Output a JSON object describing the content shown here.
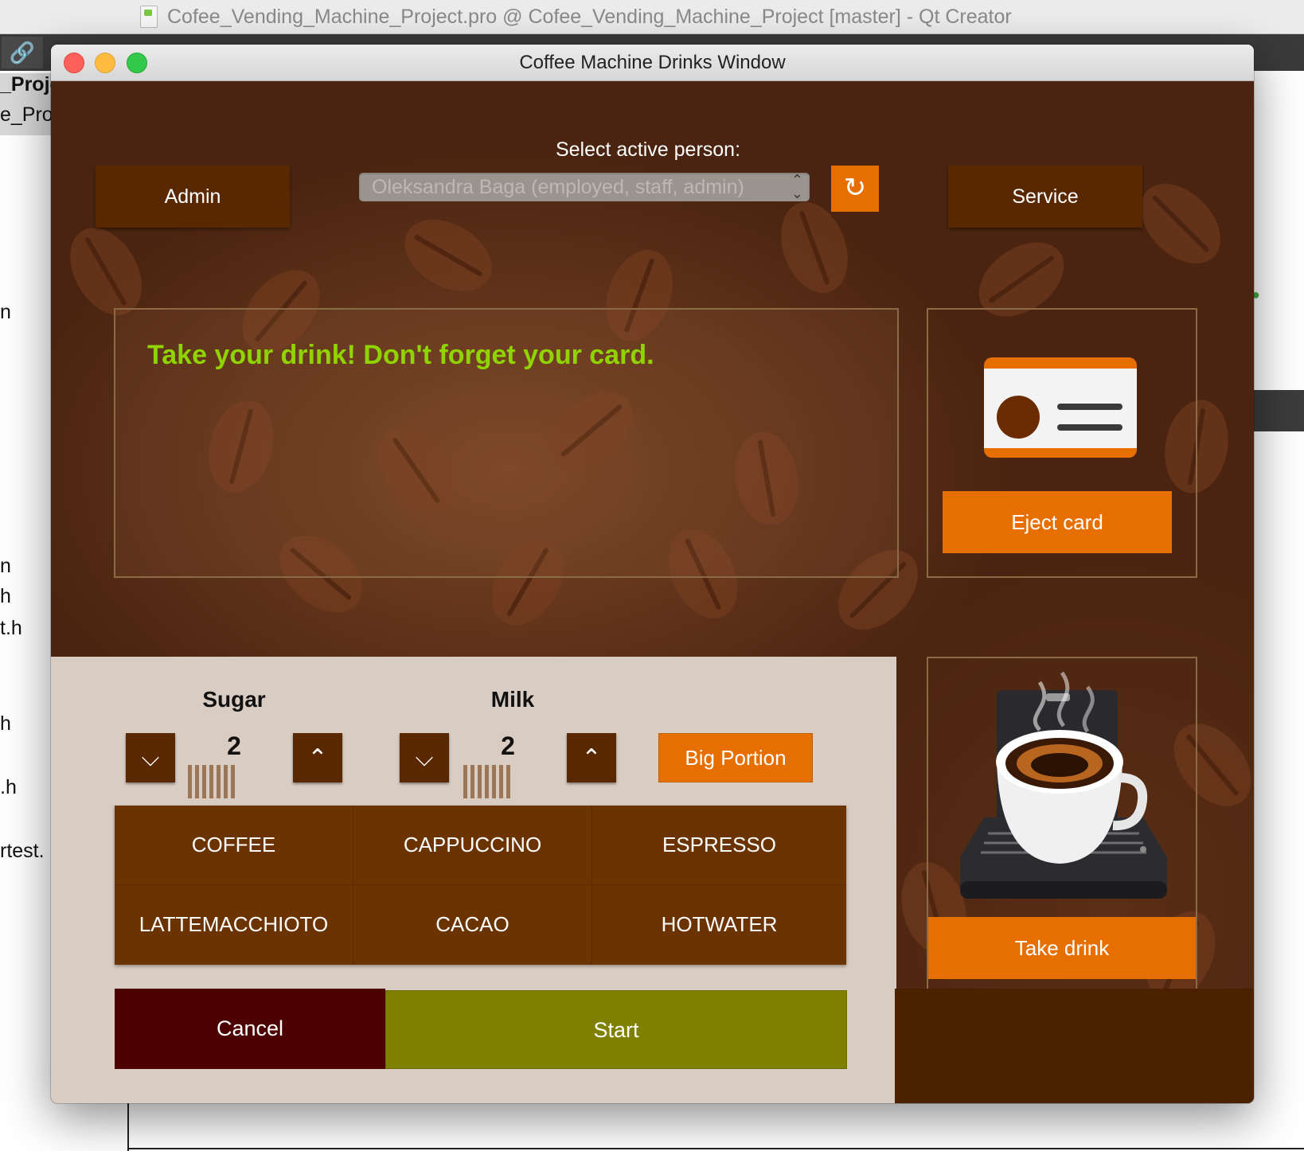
{
  "background_app": {
    "title": "Cofee_Vending_Machine_Project.pro @ Cofee_Vending_Machine_Project [master] - Qt Creator",
    "sidebar_texts": [
      "_Proje",
      "e_Proj",
      "n",
      "n",
      "h",
      "t.h",
      "h",
      ".h",
      "rtest."
    ]
  },
  "dialog": {
    "title": "Coffee Machine Drinks Window",
    "admin_label": "Admin",
    "service_label": "Service",
    "person_label": "Select active person:",
    "person_selected": "Oleksandra Baga (employed, staff, admin)",
    "message": "Take your drink! Don't forget your card.",
    "eject_card_label": "Eject card",
    "take_drink_label": "Take drink",
    "sugar": {
      "title": "Sugar",
      "value": "2",
      "level": 2
    },
    "milk": {
      "title": "Milk",
      "value": "2",
      "level": 2
    },
    "big_portion_label": "Big Portion",
    "drinks": [
      "COFFEE",
      "CAPPUCCINO",
      "ESPRESSO",
      "LATTEMACCHIOTO",
      "CACAO",
      "HOTWATER"
    ],
    "cancel_label": "Cancel",
    "start_label": "Start"
  },
  "icons": {
    "refresh": "refresh-icon",
    "chevron_down": "chevron-down-icon",
    "chevron_up": "chevron-up-icon",
    "card": "id-card-icon",
    "coffee": "coffee-machine-image"
  },
  "colors": {
    "accent_orange": "#e76f00",
    "dark_brown": "#5a2800",
    "message_green": "#8fd400",
    "cancel": "#4d0000",
    "start": "#808000"
  }
}
